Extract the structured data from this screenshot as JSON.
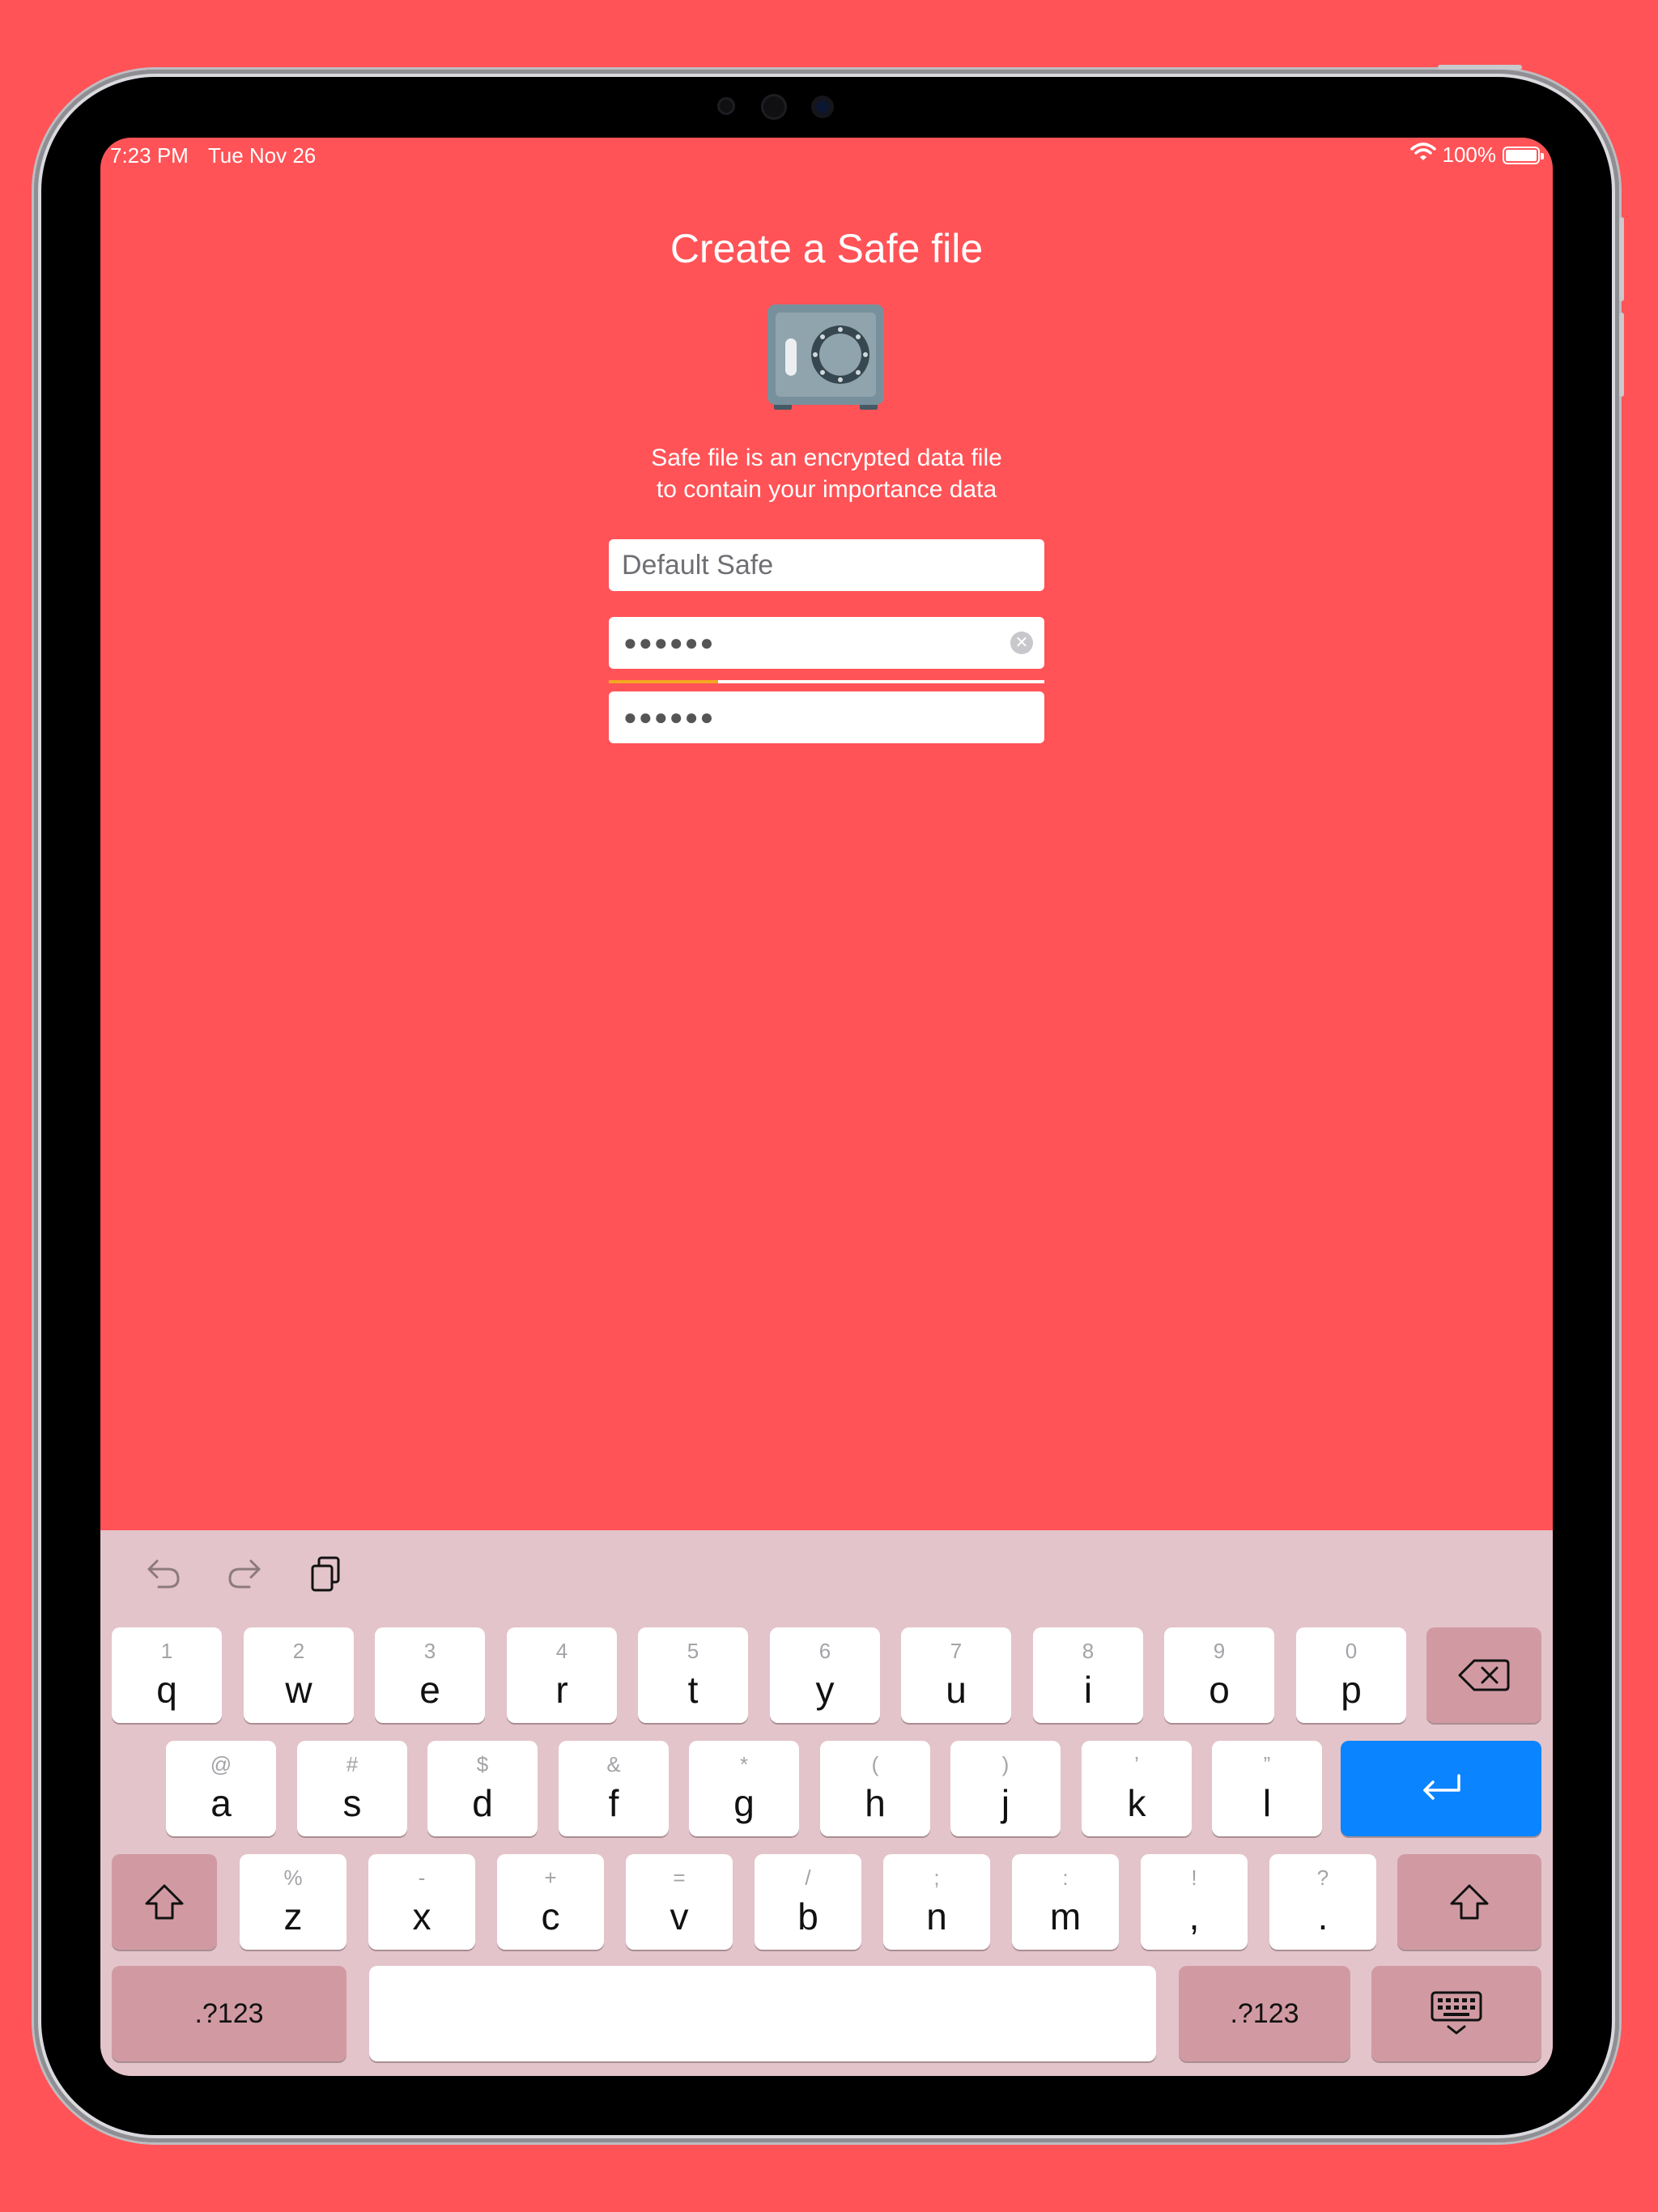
{
  "status_bar": {
    "time": "7:23 PM",
    "date": "Tue Nov 26",
    "battery_percent": "100%",
    "battery_level": 1.0,
    "wifi_icon": "wifi-icon"
  },
  "screen": {
    "title": "Create a Safe file",
    "safe_icon": "safe-icon",
    "subtitle_line1": "Safe file is an encrypted data file",
    "subtitle_line2": "to contain your importance data",
    "background_color": "#FF5357"
  },
  "form": {
    "name_placeholder": "Default Safe",
    "password_masked": "●●●●●●",
    "confirm_masked": "●●●●●●",
    "clear_icon": "clear-icon",
    "strength_level": 0.25,
    "strength_color": "#F5A623"
  },
  "keyboard": {
    "toolbar": [
      "undo-icon",
      "redo-icon",
      "paste-icon"
    ],
    "row1": [
      {
        "hint": "1",
        "label": "q"
      },
      {
        "hint": "2",
        "label": "w"
      },
      {
        "hint": "3",
        "label": "e"
      },
      {
        "hint": "4",
        "label": "r"
      },
      {
        "hint": "5",
        "label": "t"
      },
      {
        "hint": "6",
        "label": "y"
      },
      {
        "hint": "7",
        "label": "u"
      },
      {
        "hint": "8",
        "label": "i"
      },
      {
        "hint": "9",
        "label": "o"
      },
      {
        "hint": "0",
        "label": "p"
      }
    ],
    "row2": [
      {
        "hint": "@",
        "label": "a"
      },
      {
        "hint": "#",
        "label": "s"
      },
      {
        "hint": "$",
        "label": "d"
      },
      {
        "hint": "&",
        "label": "f"
      },
      {
        "hint": "*",
        "label": "g"
      },
      {
        "hint": "(",
        "label": "h"
      },
      {
        "hint": ")",
        "label": "j"
      },
      {
        "hint": "’",
        "label": "k"
      },
      {
        "hint": "”",
        "label": "l"
      }
    ],
    "row3": [
      {
        "hint": "%",
        "label": "z"
      },
      {
        "hint": "-",
        "label": "x"
      },
      {
        "hint": "+",
        "label": "c"
      },
      {
        "hint": "=",
        "label": "v"
      },
      {
        "hint": "/",
        "label": "b"
      },
      {
        "hint": ";",
        "label": "n"
      },
      {
        "hint": ":",
        "label": "m"
      },
      {
        "hint": "!",
        "label": ","
      },
      {
        "hint": "?",
        "label": "."
      }
    ],
    "numbers_left": ".?123",
    "numbers_right": ".?123",
    "backspace_icon": "backspace-icon",
    "return_icon": "return-icon",
    "shift_icon": "shift-icon",
    "dismiss_icon": "keyboard-dismiss-icon",
    "return_color": "#0A84FF"
  }
}
